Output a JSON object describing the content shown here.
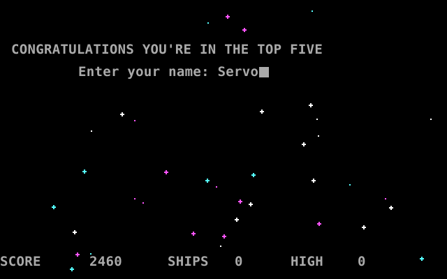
{
  "game": {
    "headline": "CONGRATULATIONS YOU'RE IN THE TOP FIVE",
    "prompt": "Enter your name: ",
    "name_value": "Servo"
  },
  "hud": {
    "score_label": "SCORE",
    "score_value": "2460",
    "ships_label": "SHIPS",
    "ships_value": "0",
    "high_label": "HIGH",
    "high_value": "0"
  },
  "colors": {
    "background": "#000000",
    "text": "#aaaaaa",
    "star_white": "#ffffff",
    "star_magenta": "#ff55ff",
    "star_cyan": "#55ffff"
  }
}
